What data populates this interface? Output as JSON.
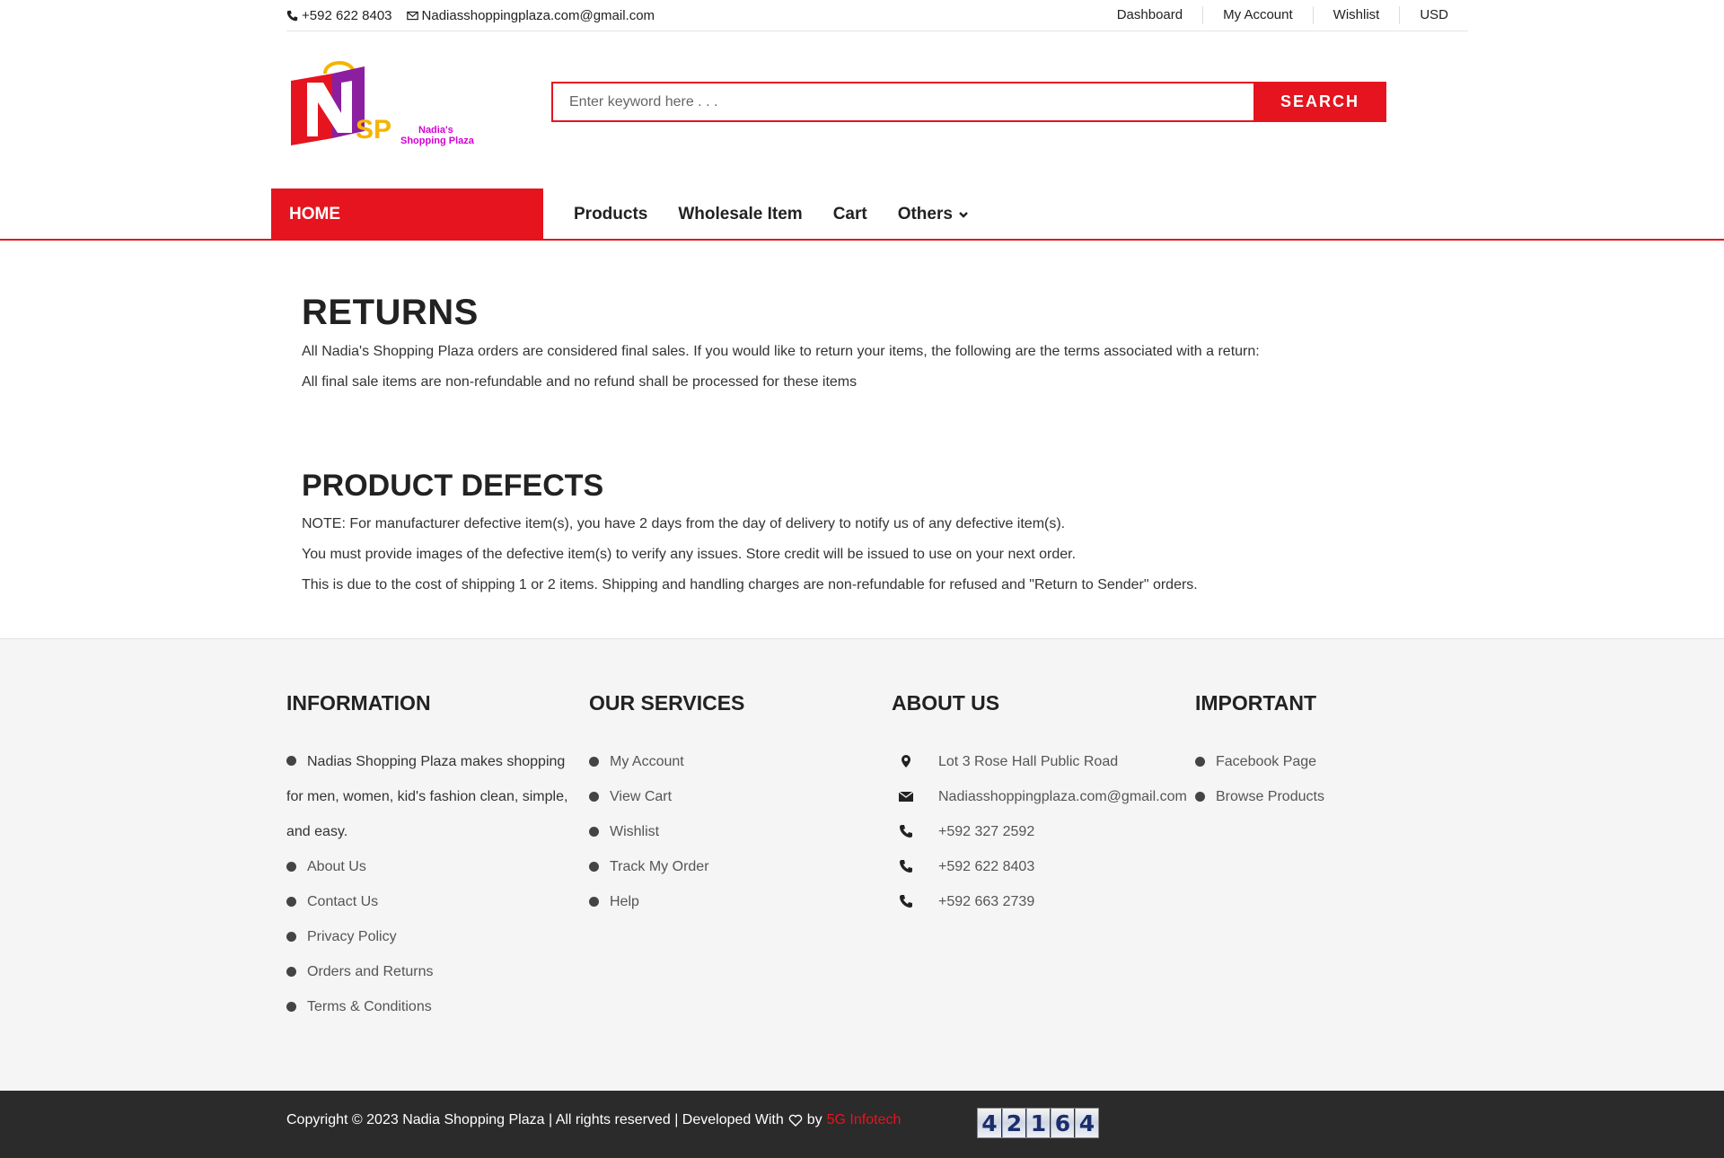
{
  "topbar": {
    "phone": "+592 622 8403",
    "email": "Nadiasshoppingplaza.com@gmail.com",
    "links": [
      "Dashboard",
      "My Account",
      "Wishlist",
      "USD"
    ]
  },
  "logo": {
    "mark": "N",
    "short": "SP",
    "name_line1": "Nadia's",
    "name_line2": "Shopping Plaza"
  },
  "search": {
    "placeholder": "Enter keyword here . . .",
    "button": "SEARCH"
  },
  "nav": {
    "home": "HOME",
    "items": [
      "Products",
      "Wholesale Item",
      "Cart",
      "Others"
    ]
  },
  "returns": {
    "title": "RETURNS",
    "lines": [
      "All  Nadia's Shopping Plaza orders are considered final sales. If you would like to return your items, the following are the terms associated with a return:",
      "All final sale items are non-refundable and no refund shall be processed for these items"
    ]
  },
  "defects": {
    "title": "PRODUCT DEFECTS",
    "lines": [
      "NOTE: For manufacturer defective item(s), you have 2 days from the day of delivery to notify us of any defective item(s).",
      "You must provide images of the defective item(s) to verify any issues. Store credit will be issued to use on your next order.",
      "This is due to the cost of shipping 1 or 2 items. Shipping and handling charges are non-refundable for refused and \"Return to Sender\" orders."
    ]
  },
  "footer": {
    "information": {
      "title": "INFORMATION",
      "intro": "Nadias Shopping Plaza makes shopping for men, women, kid's fashion clean, simple, and easy.",
      "links": [
        "About Us",
        "Contact Us",
        "Privacy Policy",
        "Orders and Returns",
        "Terms & Conditions"
      ]
    },
    "services": {
      "title": "OUR SERVICES",
      "links": [
        "My Account",
        "View Cart",
        "Wishlist",
        "Track My Order",
        "Help"
      ]
    },
    "about": {
      "title": "ABOUT US",
      "address": "Lot 3 Rose Hall Public Road",
      "email": "Nadiasshoppingplaza.com@gmail.com",
      "phones": [
        "+592 327 2592",
        "+592 622 8403",
        "+592 663 2739"
      ]
    },
    "important": {
      "title": "IMPORTANT",
      "links": [
        "Facebook Page",
        "Browse Products"
      ]
    }
  },
  "bottom": {
    "copyright": "Copyright © 2023 Nadia Shopping Plaza | All rights reserved | Developed With",
    "by": "by",
    "developer": "5G Infotech",
    "counter_digits": [
      "4",
      "2",
      "1",
      "6",
      "4"
    ]
  },
  "colors": {
    "accent": "#e5141e",
    "footer_bg": "#f5f5f5",
    "bottom_bg": "#2b2b2b"
  }
}
